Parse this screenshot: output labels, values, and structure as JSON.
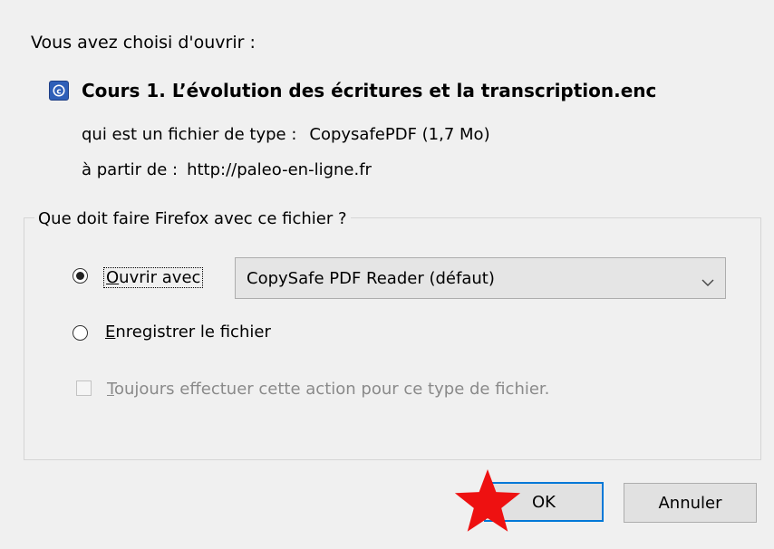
{
  "dialog": {
    "intro": "Vous avez choisi d'ouvrir :",
    "file_icon": "copysafe-file-icon",
    "file_name": "Cours 1. L’évolution des écritures et la transcription.enc",
    "type_label": "qui est un fichier de type :",
    "type_value": "CopysafePDF (1,7 Mo)",
    "source_label": "à partir de :",
    "source_value": "http://paleo-en-ligne.fr"
  },
  "action_group": {
    "title": "Que doit faire Firefox avec ce fichier ?",
    "open_with": {
      "accesskey": "O",
      "rest": "uvrir avec",
      "selected": true
    },
    "app_select": {
      "value": "CopySafe PDF Reader (défaut)"
    },
    "save_file": {
      "accesskey": "E",
      "rest": "nregistrer le fichier",
      "selected": false
    },
    "always": {
      "accesskey": "T",
      "rest": "oujours effectuer cette action pour ce type de fichier.",
      "checked": false,
      "disabled": true
    }
  },
  "buttons": {
    "ok": "OK",
    "cancel": "Annuler"
  },
  "annotation": {
    "star_icon": "red-star-icon",
    "color": "#ee1111"
  }
}
